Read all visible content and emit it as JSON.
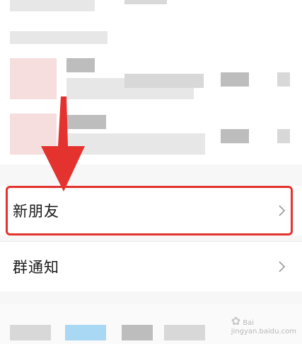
{
  "list": {
    "items": [
      {
        "label": "新朋友"
      },
      {
        "label": "群通知"
      }
    ]
  },
  "colors": {
    "highlight": "#e4332f",
    "arrow": "#e4332f"
  },
  "watermark": {
    "line1": "Bai",
    "line2": "jingyan.baidu.com"
  }
}
